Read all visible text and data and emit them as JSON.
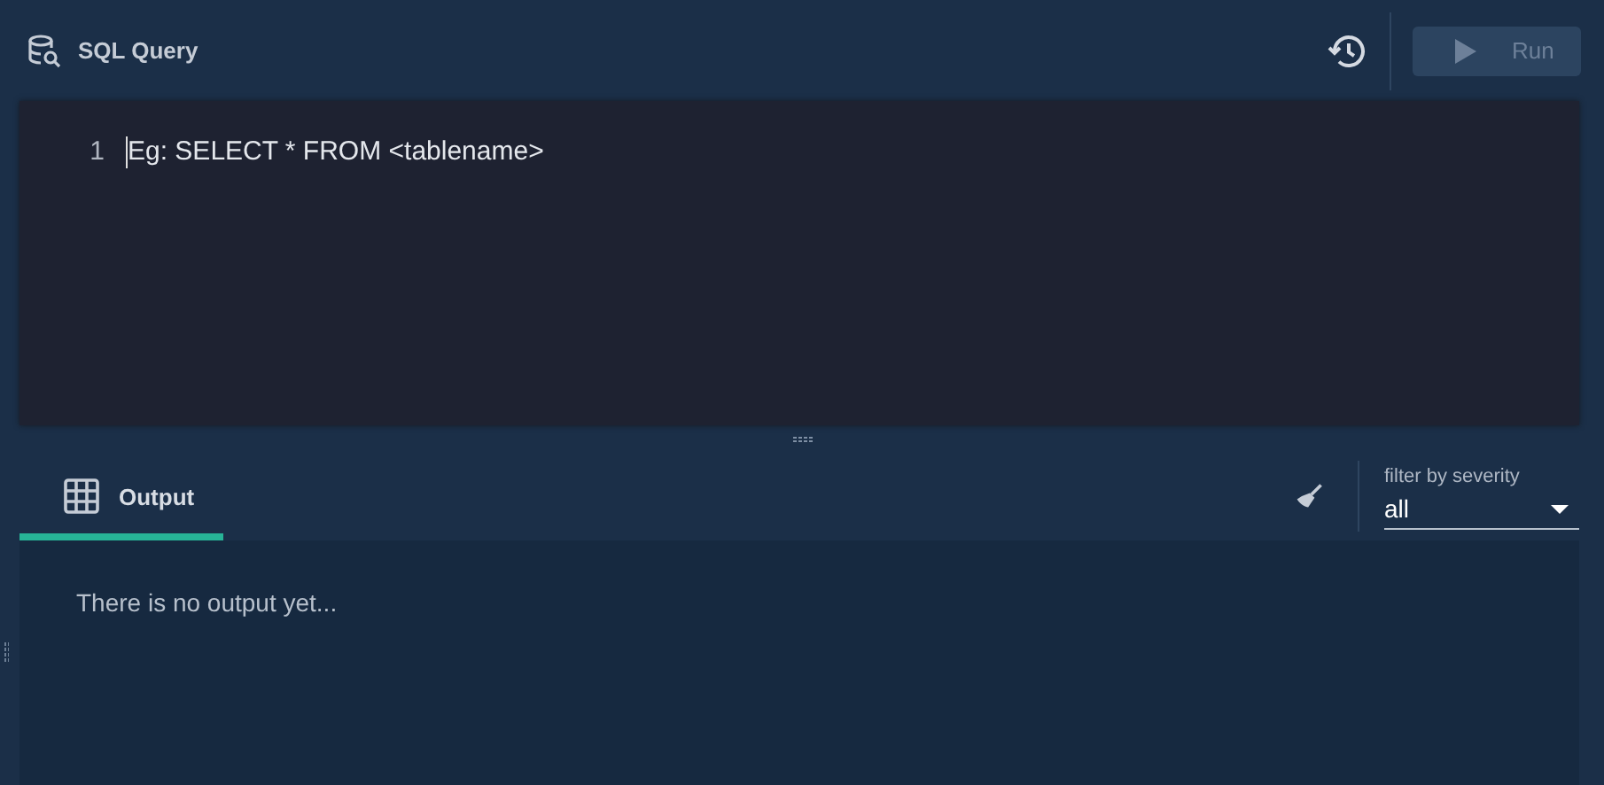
{
  "header": {
    "title": "SQL Query",
    "run_button": {
      "label": "Run",
      "disabled": true
    }
  },
  "editor": {
    "line_numbers": [
      "1"
    ],
    "placeholder": "Eg: SELECT * FROM <tablename>"
  },
  "output": {
    "tabs": [
      {
        "label": "Output",
        "selected": true
      }
    ],
    "filter": {
      "label": "filter by severity",
      "value": "all"
    },
    "message": "There is no output yet..."
  }
}
